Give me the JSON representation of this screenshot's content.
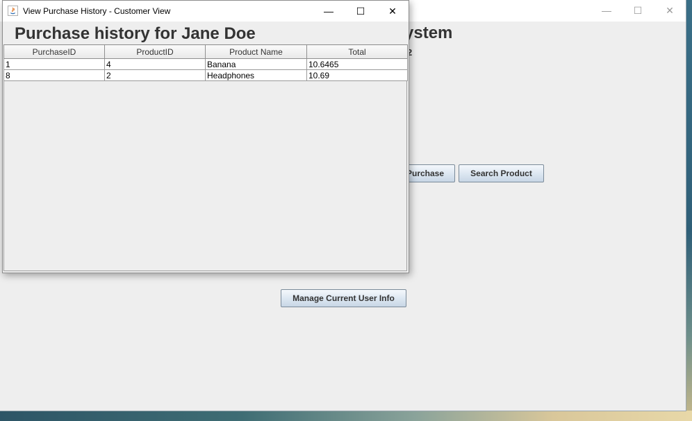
{
  "main_window": {
    "title_partial": "ystem",
    "subtext_partial": "2",
    "controls": {
      "minimize": "—",
      "maximize": "☐",
      "close": "✕"
    },
    "buttons": {
      "purchase": "Purchase",
      "search_product": "Search Product",
      "manage_user": "Manage Current User Info"
    }
  },
  "dialog": {
    "title": "View Purchase History - Customer View",
    "heading": "Purchase history for Jane Doe",
    "controls": {
      "minimize": "—",
      "maximize": "☐",
      "close": "✕"
    },
    "table": {
      "columns": [
        "PurchaseID",
        "ProductID",
        "Product Name",
        "Total"
      ],
      "rows": [
        [
          "1",
          "4",
          "Banana",
          "10.6465"
        ],
        [
          "8",
          "2",
          "Headphones",
          "10.69"
        ]
      ]
    }
  }
}
